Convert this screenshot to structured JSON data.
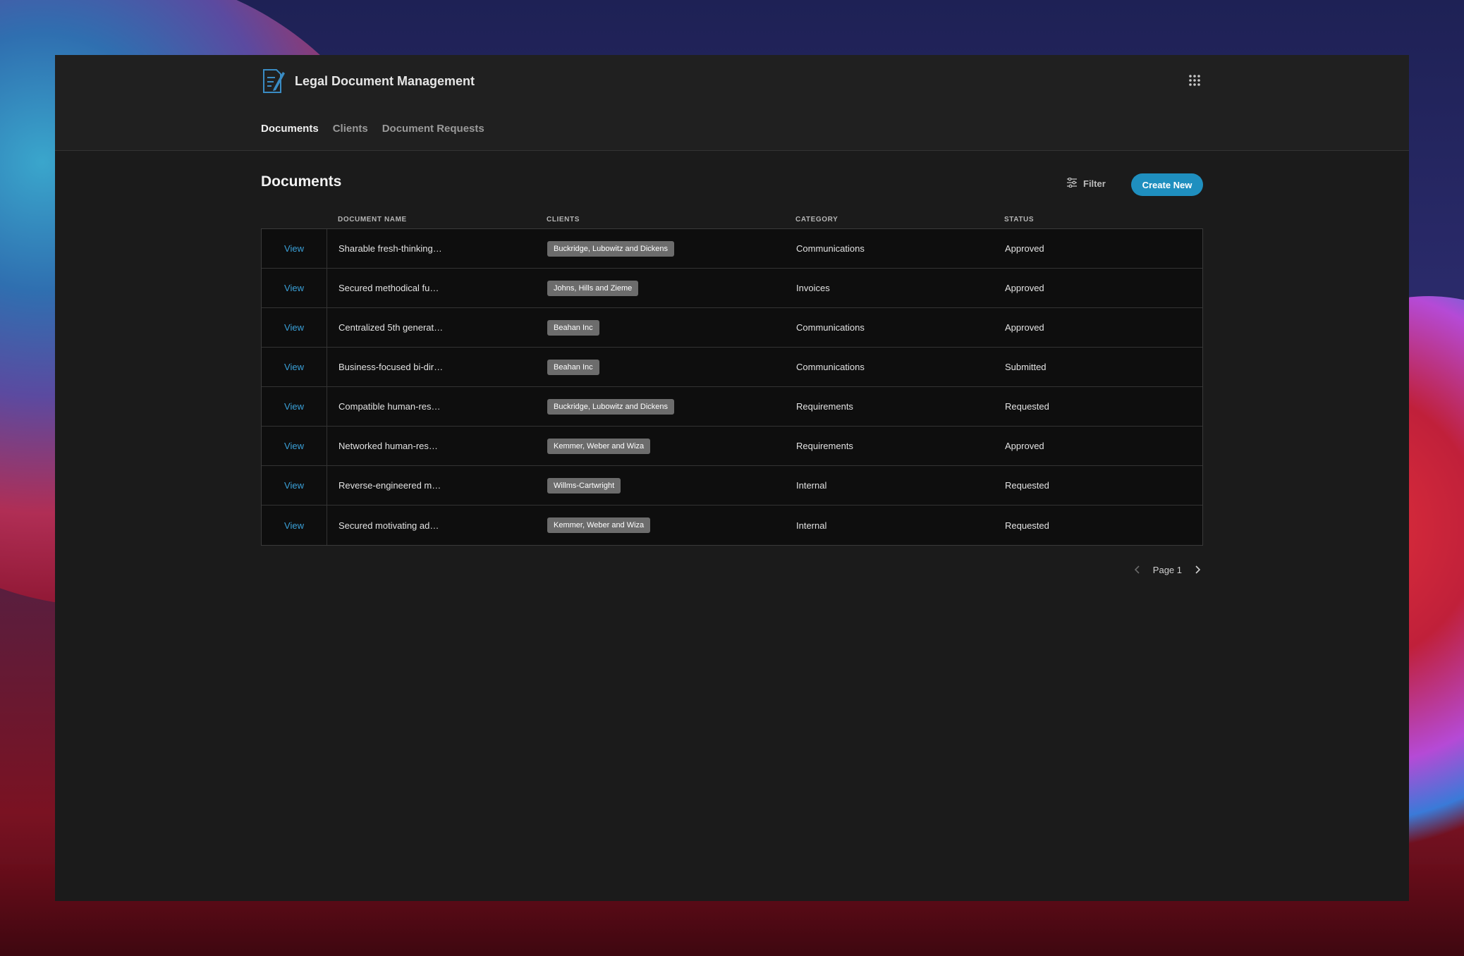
{
  "app": {
    "title": "Legal Document Management"
  },
  "tabs": [
    {
      "label": "Documents",
      "active": true
    },
    {
      "label": "Clients",
      "active": false
    },
    {
      "label": "Document Requests",
      "active": false
    }
  ],
  "page": {
    "title": "Documents",
    "filter_label": "Filter",
    "create_label": "Create New"
  },
  "table": {
    "headers": {
      "name": "DOCUMENT NAME",
      "clients": "CLIENTS",
      "category": "CATEGORY",
      "status": "STATUS"
    },
    "rows": [
      {
        "action": "View",
        "name": "Sharable fresh-thinking…",
        "client": "Buckridge, Lubowitz and Dickens",
        "category": "Communications",
        "status": "Approved"
      },
      {
        "action": "View",
        "name": "Secured methodical fu…",
        "client": "Johns, Hills and Zieme",
        "category": "Invoices",
        "status": "Approved"
      },
      {
        "action": "View",
        "name": "Centralized 5th generat…",
        "client": "Beahan Inc",
        "category": "Communications",
        "status": "Approved"
      },
      {
        "action": "View",
        "name": "Business-focused bi-dir…",
        "client": "Beahan Inc",
        "category": "Communications",
        "status": "Submitted"
      },
      {
        "action": "View",
        "name": "Compatible human-res…",
        "client": "Buckridge, Lubowitz and Dickens",
        "category": "Requirements",
        "status": "Requested"
      },
      {
        "action": "View",
        "name": "Networked human-res…",
        "client": "Kemmer, Weber and Wiza",
        "category": "Requirements",
        "status": "Approved"
      },
      {
        "action": "View",
        "name": "Reverse-engineered m…",
        "client": "Willms-Cartwright",
        "category": "Internal",
        "status": "Requested"
      },
      {
        "action": "View",
        "name": "Secured motivating ad…",
        "client": "Kemmer, Weber and Wiza",
        "category": "Internal",
        "status": "Requested"
      }
    ]
  },
  "pagination": {
    "label": "Page 1"
  },
  "icons": {
    "brand": "document-edit-icon",
    "apps": "grid-icon",
    "filter": "sliders-icon",
    "prev": "chevron-left-icon",
    "next": "chevron-right-icon"
  },
  "colors": {
    "accent": "#1f8fbf",
    "link": "#3aa0d8",
    "badge": "#6c6c6c"
  }
}
